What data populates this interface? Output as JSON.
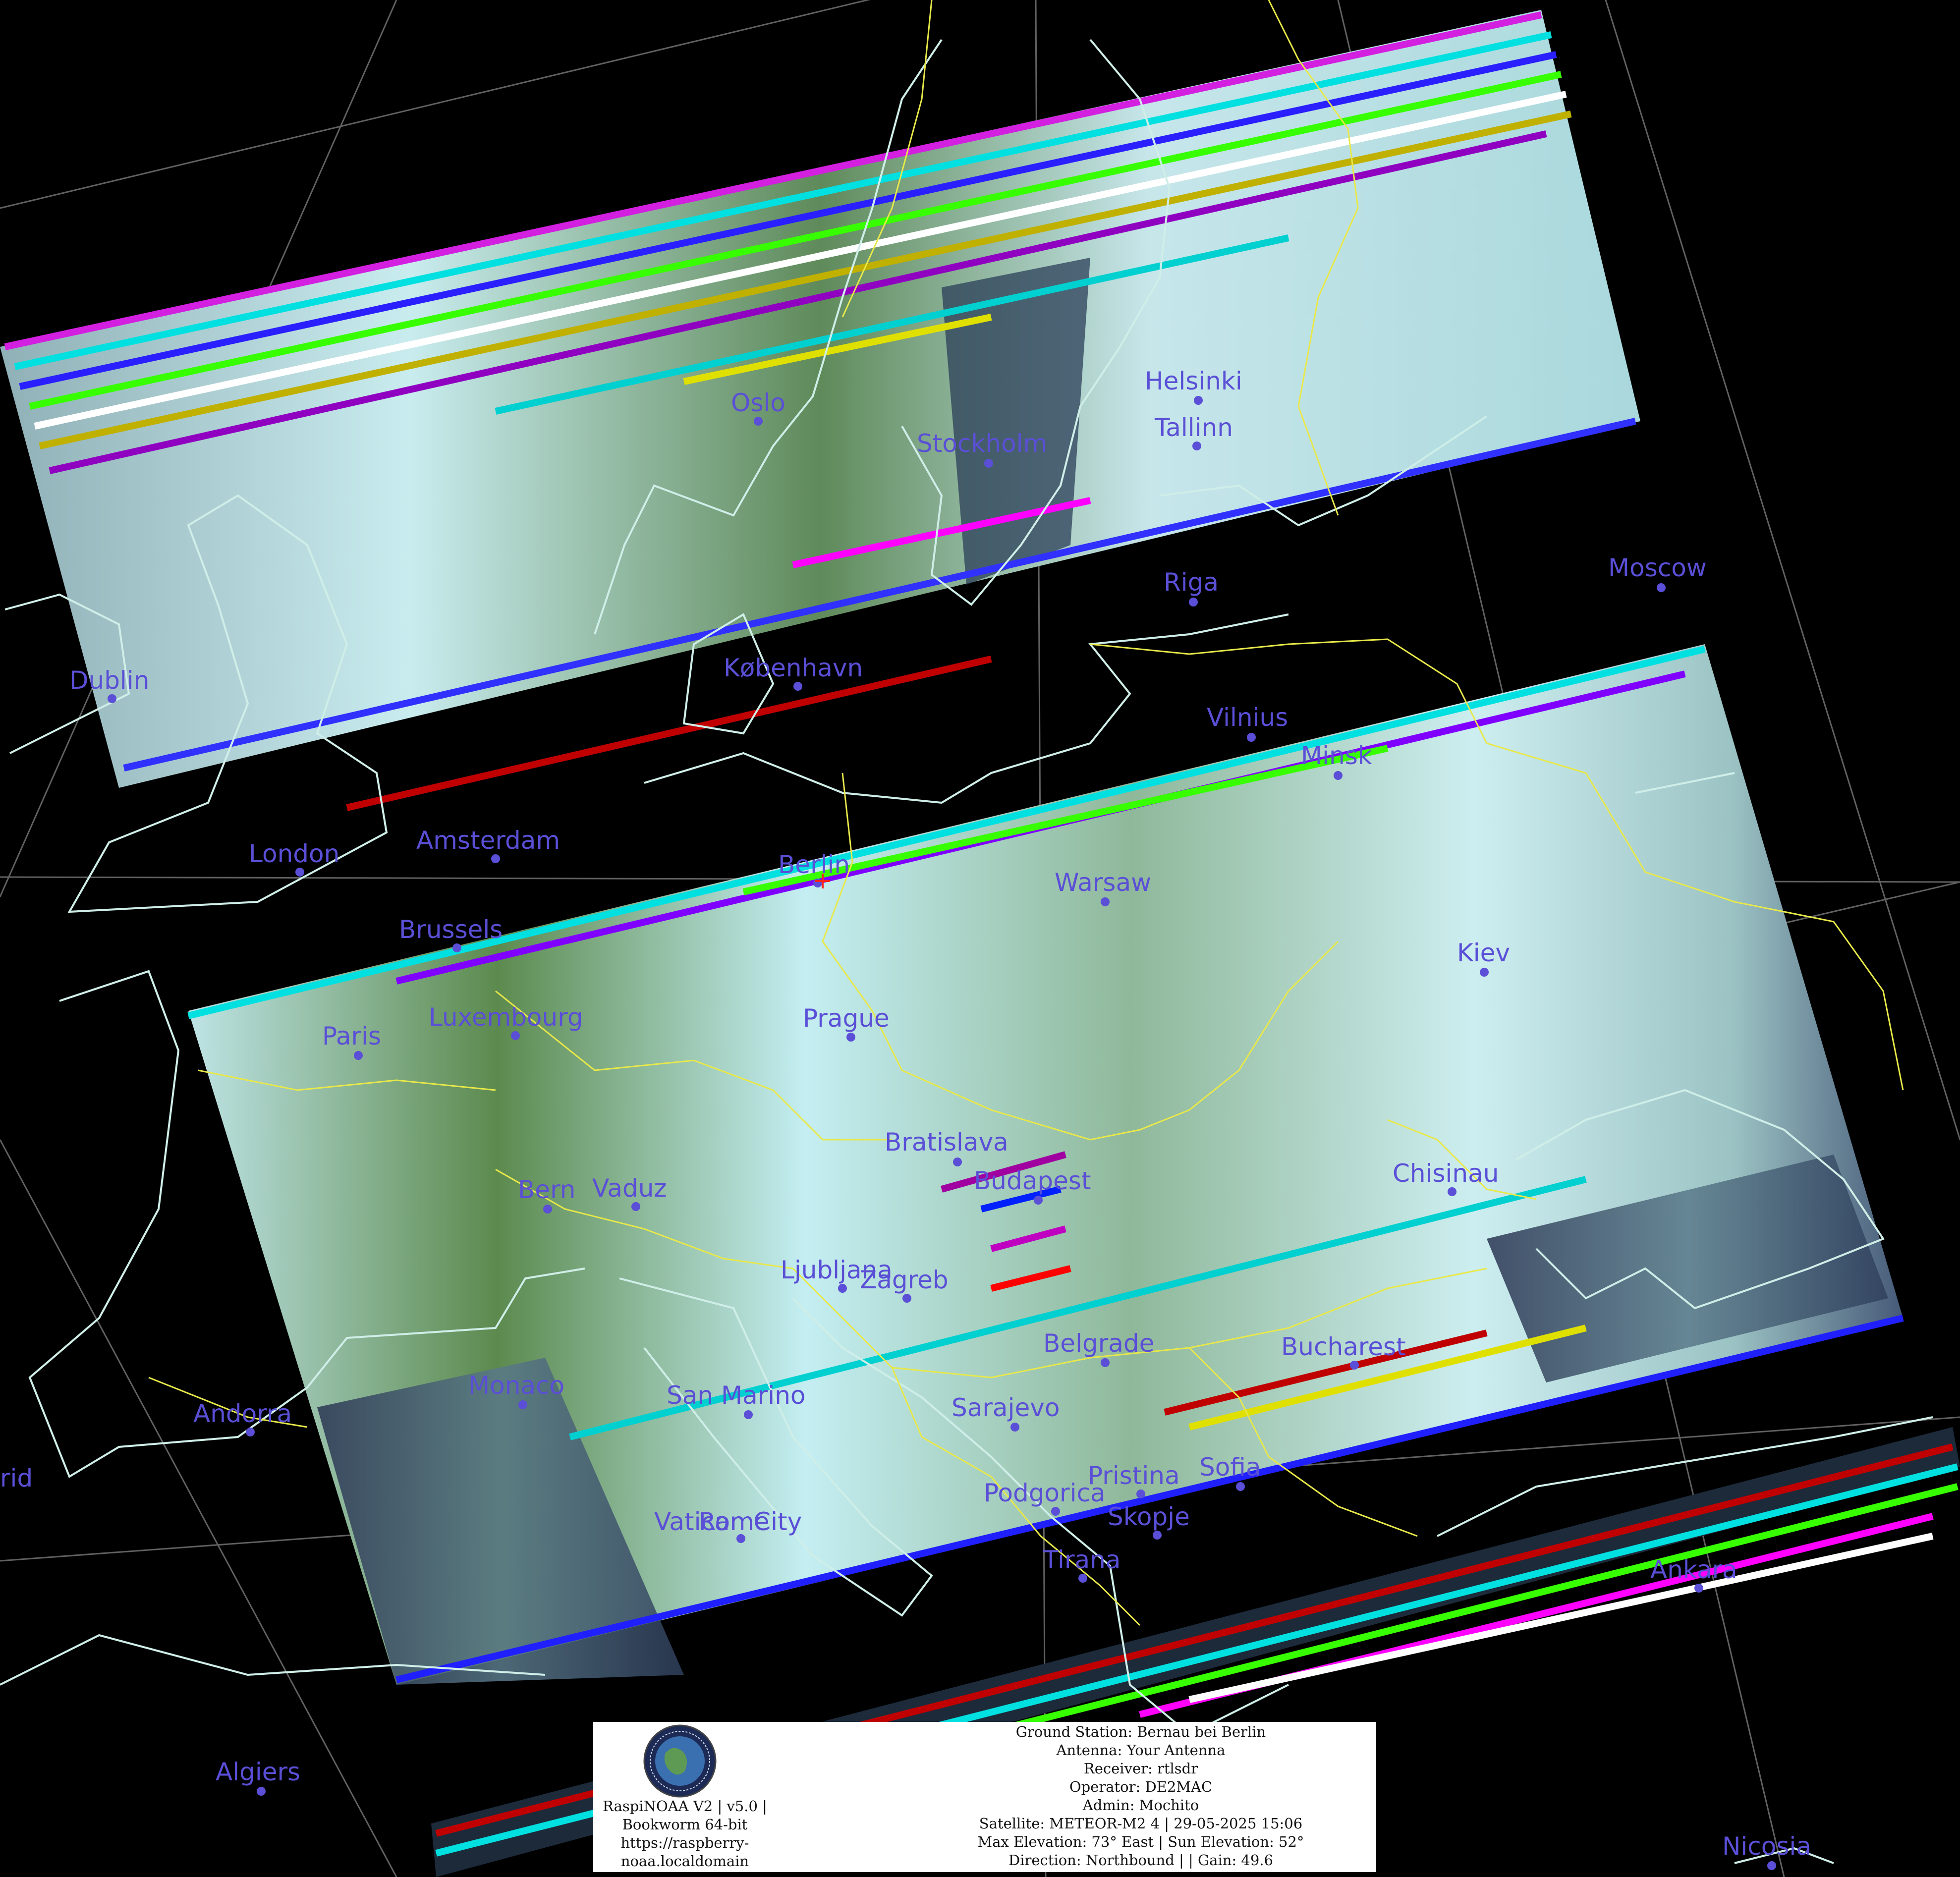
{
  "map": {
    "background": "#000000",
    "coastline_color": "#cfeee8",
    "border_color": "#e8e84a",
    "graticule_color": "#8a8a8a",
    "label_color": "#5a4fd6",
    "cities": [
      {
        "name": "Oslo"
      },
      {
        "name": "Stockholm"
      },
      {
        "name": "Helsinki"
      },
      {
        "name": "Tallinn"
      },
      {
        "name": "Riga"
      },
      {
        "name": "Moscow"
      },
      {
        "name": "Dublin"
      },
      {
        "name": "København"
      },
      {
        "name": "Vilnius"
      },
      {
        "name": "Minsk"
      },
      {
        "name": "London"
      },
      {
        "name": "Amsterdam"
      },
      {
        "name": "Berlin"
      },
      {
        "name": "Warsaw"
      },
      {
        "name": "Brussels"
      },
      {
        "name": "Luxembourg"
      },
      {
        "name": "Paris"
      },
      {
        "name": "Prague"
      },
      {
        "name": "Kiev"
      },
      {
        "name": "Bratislava"
      },
      {
        "name": "Budapest"
      },
      {
        "name": "Bern"
      },
      {
        "name": "Vaduz"
      },
      {
        "name": "Chisinau"
      },
      {
        "name": "Ljubljana"
      },
      {
        "name": "Zagreb"
      },
      {
        "name": "Belgrade"
      },
      {
        "name": "Bucharest"
      },
      {
        "name": "Monaco"
      },
      {
        "name": "San Marino"
      },
      {
        "name": "Sarajevo"
      },
      {
        "name": "Andorra"
      },
      {
        "name": "rid"
      },
      {
        "name": "Pristina"
      },
      {
        "name": "Sofia"
      },
      {
        "name": "Podgorica"
      },
      {
        "name": "Skopje"
      },
      {
        "name": "Vatican City"
      },
      {
        "name": "Rome"
      },
      {
        "name": "Tirana"
      },
      {
        "name": "Ankara"
      },
      {
        "name": "Algiers"
      },
      {
        "name": "Nicosia"
      }
    ]
  },
  "info": {
    "logo": "raspinoaa-globe-logo",
    "software": [
      "RaspiNOAA V2 | v5.0 |",
      "Bookworm 64-bit",
      "https://raspberry-",
      "noaa.localdomain"
    ],
    "station": [
      "Ground Station: Bernau bei Berlin",
      "Antenna: Your Antenna",
      "Receiver: rtlsdr",
      "Operator: DE2MAC",
      "Admin: Mochito",
      "Satellite: METEOR-M2 4 | 29-05-2025 15:06",
      "Max Elevation: 73° East | Sun Elevation: 52°",
      "Direction: Northbound | | Gain: 49.6"
    ]
  }
}
